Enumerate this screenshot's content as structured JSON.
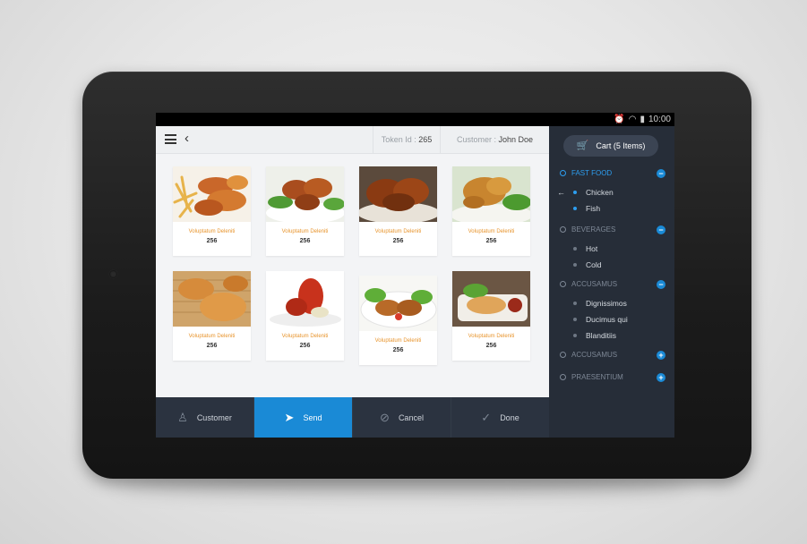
{
  "status_bar": {
    "alarm_icon": "alarm-icon",
    "wifi_icon": "wifi-icon",
    "battery_icon": "battery-icon",
    "time": "10:00"
  },
  "header": {
    "token_label": "Token Id :",
    "token_value": "265",
    "customer_label": "Customer :",
    "customer_value": "John Doe"
  },
  "products": [
    {
      "name": "Voluptatum Deleniti",
      "price": "256"
    },
    {
      "name": "Voluptatum Deleniti",
      "price": "256"
    },
    {
      "name": "Voluptatum Deleniti",
      "price": "256"
    },
    {
      "name": "Voluptatum Deleniti",
      "price": "256"
    },
    {
      "name": "Voluptatum Deleniti",
      "price": "256"
    },
    {
      "name": "Voluptatum Deleniti",
      "price": "256"
    },
    {
      "name": "Voluptatum Deleniti",
      "price": "256"
    },
    {
      "name": "Voluptatum Deleniti",
      "price": "256"
    }
  ],
  "actions": {
    "customer": "Customer",
    "send": "Send",
    "cancel": "Cancel",
    "done": "Done"
  },
  "sidebar": {
    "cart_label": "Cart  (5 Items)",
    "categories": [
      {
        "label": "FAST FOOD",
        "toggle": "−",
        "items": [
          "Chicken",
          "Fish"
        ]
      },
      {
        "label": "BEVERAGES",
        "toggle": "−",
        "items": [
          "Hot",
          "Cold"
        ]
      },
      {
        "label": "ACCUSAMUS",
        "toggle": "−",
        "items": [
          "Dignissimos",
          "Ducimus qui",
          "Blanditiis"
        ]
      },
      {
        "label": "ACCUSAMUS",
        "toggle": "+",
        "items": []
      },
      {
        "label": "PRAESENTIUM",
        "toggle": "+",
        "items": []
      }
    ]
  },
  "colors": {
    "accent": "#1a8ad6",
    "sidebar_bg": "#262d38",
    "bottom_bar_bg": "#2b3340",
    "product_name": "#e8942c"
  }
}
